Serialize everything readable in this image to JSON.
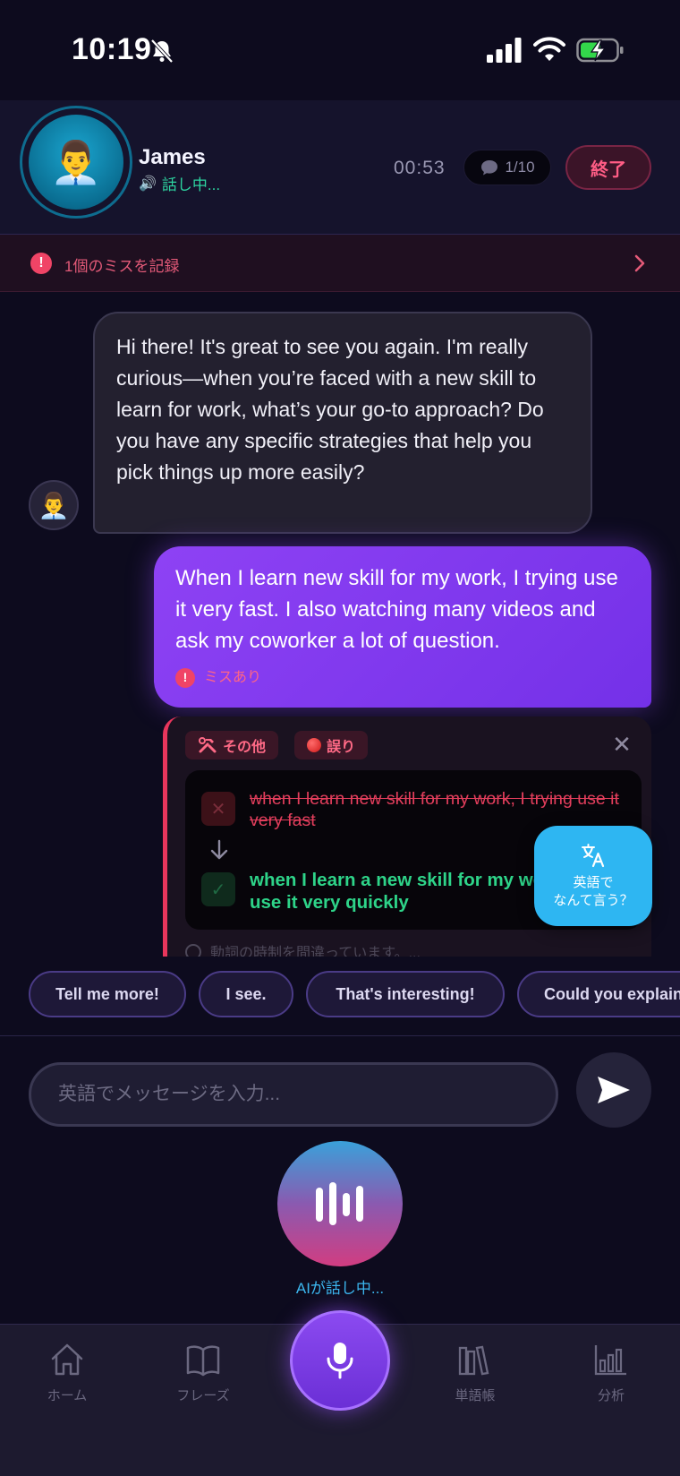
{
  "status_bar": {
    "time": "10:19"
  },
  "header": {
    "name": "James",
    "speaking": "話し中...",
    "timer": "00:53",
    "turn_count": "1/10",
    "end_label": "終了",
    "avatar_emoji": "👨‍💼"
  },
  "mistake_banner": {
    "text": "1個のミスを記録"
  },
  "chat": {
    "ai_message": "Hi there! It's great to see you again. I'm really curious—when you’re faced with a new skill to learn for work, what’s your go-to approach? Do you have any specific strategies that help you pick things up more easily?",
    "user_message": "When I learn new skill for my work, I trying use it very fast. I also watching many videos and ask my coworker a lot of question.",
    "user_error_label": "ミスあり",
    "correction": {
      "tag_category": "その他",
      "tag_type": "誤り",
      "wrong": "when I learn new skill for my work, I trying use it very fast",
      "right": "when I learn a new skill for my work, I try to use it very quickly",
      "footer": "動詞の時制を間違っています。..."
    },
    "translate_button": {
      "line1": "英語で",
      "line2": "なんて言う？"
    }
  },
  "quick_replies": [
    "Tell me more!",
    "I see.",
    "That's interesting!",
    "Could you explain"
  ],
  "input": {
    "placeholder": "英語でメッセージを入力..."
  },
  "voice": {
    "status": "AIが話し中..."
  },
  "tabs": {
    "home": "ホーム",
    "phrases": "フレーズ",
    "vocab": "単語帳",
    "analysis": "分析"
  },
  "colors": {
    "background": "#0d0b1e",
    "accent_purple": "#7a35ec",
    "error_red": "#f04466",
    "success_green": "#2ed489",
    "translate_blue": "#2eb6f2"
  }
}
